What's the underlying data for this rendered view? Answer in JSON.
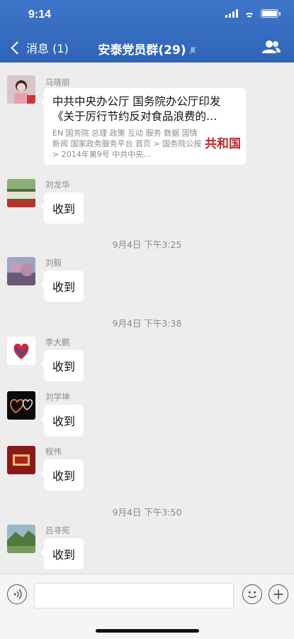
{
  "status_bar": {
    "time": "9:14"
  },
  "nav": {
    "back_label": "消息 (1)",
    "title": "安泰党员群(29)"
  },
  "colors": {
    "nav_bg": "#2f64b8",
    "chat_bg": "#ededed",
    "bubble_bg": "#ffffff"
  },
  "messages": [
    {
      "sender": "马晓丽",
      "type": "link",
      "title": "中共中央办公厅 国务院办公厅印发《关于厉行节约反对食品浪费的…",
      "desc": "EN 国务院 总理 政策 互动 服务 数据 国情 新闻 国家政务服务平台 首页 > 国务院公报 > 2014年第9号 中共中央…",
      "thumb_text": "共和国"
    },
    {
      "sender": "刘龙华",
      "text": "收到"
    },
    {
      "time": "9月4日 下午3:25"
    },
    {
      "sender": "刘毅",
      "text": "收到"
    },
    {
      "time": "9月4日 下午3:38"
    },
    {
      "sender": "李大鹏",
      "text": "收到"
    },
    {
      "sender": "刘学坤",
      "text": "收到"
    },
    {
      "sender": "程伟",
      "text": "收到"
    },
    {
      "time": "9月4日 下午3:50"
    },
    {
      "sender": "吕寻宪",
      "text": "收到"
    }
  ],
  "input": {
    "value": "",
    "placeholder": ""
  },
  "icons": [
    "back-chevron-icon",
    "mute-icon",
    "members-icon",
    "voice-icon",
    "emoji-icon",
    "plus-icon"
  ]
}
